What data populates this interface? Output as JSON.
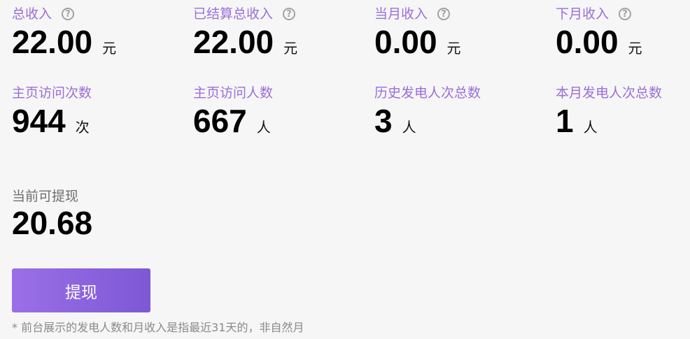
{
  "stats": [
    {
      "label": "总收入",
      "value": "22.00",
      "unit": "元",
      "has_help": true
    },
    {
      "label": "已结算总收入",
      "value": "22.00",
      "unit": "元",
      "has_help": true
    },
    {
      "label": "当月收入",
      "value": "0.00",
      "unit": "元",
      "has_help": true
    },
    {
      "label": "下月收入",
      "value": "0.00",
      "unit": "元",
      "has_help": true
    },
    {
      "label": "主页访问次数",
      "value": "944",
      "unit": "次",
      "has_help": false
    },
    {
      "label": "主页访问人数",
      "value": "667",
      "unit": "人",
      "has_help": false
    },
    {
      "label": "历史发电人次总数",
      "value": "3",
      "unit": "人",
      "has_help": false
    },
    {
      "label": "本月发电人次总数",
      "value": "1",
      "unit": "人",
      "has_help": false
    }
  ],
  "help_icon_glyph": "?",
  "withdrawable": {
    "label": "当前可提现",
    "value": "20.68"
  },
  "withdraw_button_label": "提现",
  "footnote": "* 前台展示的发电人数和月收入是指最近31天的，非自然月",
  "colors": {
    "label_purple": "#9a6fd8",
    "button_gradient_start": "#9b6fe6",
    "button_gradient_end": "#7d58d6",
    "background": "#f6f6f6"
  }
}
